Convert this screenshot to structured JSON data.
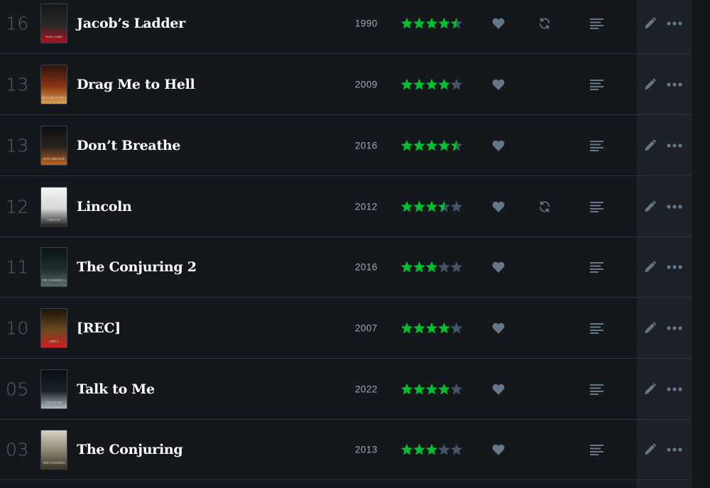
{
  "colors": {
    "star_on": "#00c030",
    "star_off": "#456",
    "icon": "#678",
    "background": "#14181c"
  },
  "diary": {
    "entries": [
      {
        "day": "16",
        "title": "Jacob’s Ladder",
        "year": "1990",
        "rating": 4.5,
        "liked": true,
        "rewatch": true,
        "review": true,
        "poster_text": "Jacob's Ladder",
        "poster_colors": [
          "#151515",
          "#2a2a2a",
          "#b01020"
        ]
      },
      {
        "day": "13",
        "title": "Drag Me to Hell",
        "year": "2009",
        "rating": 4,
        "liked": true,
        "rewatch": false,
        "review": true,
        "poster_text": "DRAG ME TO HELL",
        "poster_colors": [
          "#2b140c",
          "#8a3515",
          "#e0a050"
        ]
      },
      {
        "day": "13",
        "title": "Don’t Breathe",
        "year": "2016",
        "rating": 4.5,
        "liked": true,
        "rewatch": false,
        "review": true,
        "poster_text": "DON'T BREATHE",
        "poster_colors": [
          "#101010",
          "#2a2420",
          "#c06020"
        ]
      },
      {
        "day": "12",
        "title": "Lincoln",
        "year": "2012",
        "rating": 3.5,
        "liked": true,
        "rewatch": true,
        "review": true,
        "poster_text": "LINCOLN",
        "poster_colors": [
          "#f4f4f4",
          "#d8d8d8",
          "#202020"
        ]
      },
      {
        "day": "11",
        "title": "The Conjuring 2",
        "year": "2016",
        "rating": 3,
        "liked": true,
        "rewatch": false,
        "review": true,
        "poster_text": "THE CONJURING 2",
        "poster_colors": [
          "#0c1414",
          "#1e2e2e",
          "#5a6a66"
        ]
      },
      {
        "day": "10",
        "title": "[REC]",
        "year": "2007",
        "rating": 4,
        "liked": true,
        "rewatch": false,
        "review": true,
        "poster_text": "[•REC]",
        "poster_colors": [
          "#1a1208",
          "#6a4a20",
          "#d02020"
        ]
      },
      {
        "day": "05",
        "title": "Talk to Me",
        "year": "2022",
        "rating": 4,
        "liked": true,
        "rewatch": false,
        "review": true,
        "poster_text": "TALK TO ME",
        "poster_colors": [
          "#0a0e12",
          "#1a2228",
          "#b0b8c0"
        ]
      },
      {
        "day": "03",
        "title": "The Conjuring",
        "year": "2013",
        "rating": 3,
        "liked": true,
        "rewatch": false,
        "review": true,
        "poster_text": "THE CONJURING",
        "poster_colors": [
          "#d8d2c4",
          "#8a8270",
          "#3a3428"
        ]
      }
    ]
  }
}
